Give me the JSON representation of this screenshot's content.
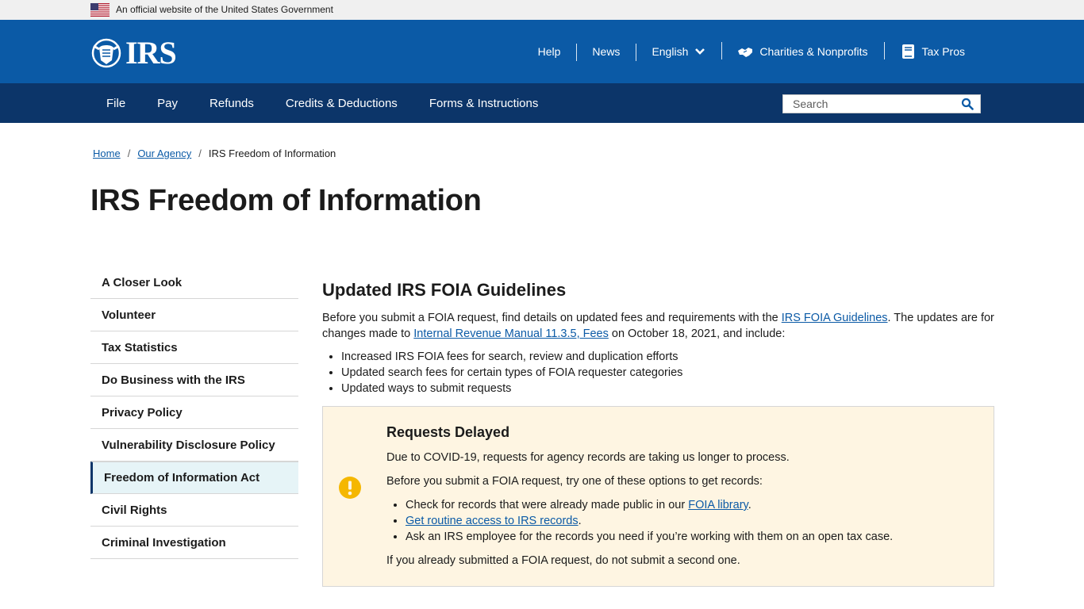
{
  "gov_banner": {
    "text": "An official website of the United States Government"
  },
  "header": {
    "logo_text": "IRS",
    "utility_nav": [
      {
        "label": "Help"
      },
      {
        "label": "News"
      },
      {
        "label": "English",
        "icon": "chevron-down-icon"
      },
      {
        "label": "Charities & Nonprofits",
        "icon": "handshake-icon"
      },
      {
        "label": "Tax Pros",
        "icon": "book-icon"
      }
    ]
  },
  "main_nav": {
    "items": [
      "File",
      "Pay",
      "Refunds",
      "Credits & Deductions",
      "Forms & Instructions"
    ],
    "search": {
      "placeholder": "Search",
      "value": ""
    }
  },
  "breadcrumb": {
    "items": [
      "Home",
      "Our Agency",
      "IRS Freedom of Information"
    ],
    "separator": "/"
  },
  "page_title": "IRS Freedom of Information",
  "sidebar": {
    "items": [
      "A Closer Look",
      "Volunteer",
      "Tax Statistics",
      "Do Business with the IRS",
      "Privacy Policy",
      "Vulnerability Disclosure Policy",
      "Freedom of Information Act",
      "Civil Rights",
      "Criminal Investigation"
    ],
    "active": "Freedom of Information Act"
  },
  "content": {
    "heading": "Updated IRS FOIA Guidelines",
    "intro": {
      "t1": "Before you submit a FOIA request, find details on updated fees and requirements with the ",
      "link1": "IRS FOIA Guidelines",
      "t2": ". The updates are for changes made to ",
      "link2": "Internal Revenue Manual 11.3.5, Fees",
      "t3": " on October 18, 2021, and include:"
    },
    "bullets": [
      "Increased IRS FOIA fees for search, review and duplication efforts",
      "Updated search fees for certain types of FOIA requester categories",
      "Updated ways to submit requests"
    ]
  },
  "alert": {
    "icon": "exclamation-icon",
    "title": "Requests Delayed",
    "p1": "Due to COVID-19, requests for agency records are taking us longer to process.",
    "p2": "Before you submit a FOIA request, try one of these options to get records:",
    "b1_text": "Check for records that were already made public in our ",
    "b1_link": "FOIA library",
    "b1_end": ".",
    "b2_link": "Get routine access to IRS records",
    "b2_end": ".",
    "b3": "Ask an IRS employee for the records you need if you’re working with them on an open tax case.",
    "p3": "If you already submitted a FOIA request, do not submit a second one."
  },
  "colors": {
    "header_blue": "#0b5aa6",
    "nav_navy": "#0c3569",
    "link": "#0b5aa6",
    "alert_bg": "#fef5e2",
    "alert_icon": "#f5b700",
    "active_bg": "#e6f4f7"
  }
}
